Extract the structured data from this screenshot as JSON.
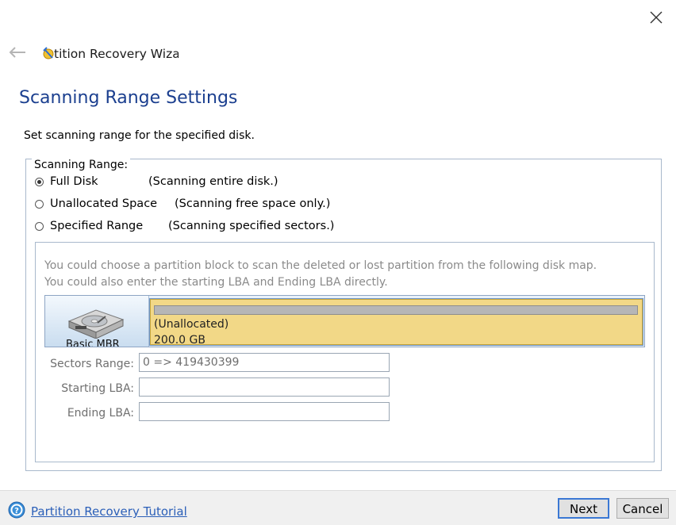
{
  "window": {
    "title": "Partition Recovery Wizard"
  },
  "header": {
    "app_title": "tition Recovery Wiza",
    "page_title": "Scanning Range Settings",
    "subtitle": "Set scanning range for the specified disk."
  },
  "scanning_range": {
    "legend": "Scanning Range:",
    "options": [
      {
        "label": "Full Disk",
        "description": "(Scanning entire disk.)",
        "selected": true
      },
      {
        "label": "Unallocated Space",
        "description": "(Scanning free space only.)",
        "selected": false
      },
      {
        "label": "Specified Range",
        "description": "(Scanning specified sectors.)",
        "selected": false
      }
    ]
  },
  "specified_range": {
    "info_line1": "You could choose a partition block to scan the deleted or lost partition from the following disk map.",
    "info_line2": "You could also enter the starting LBA and Ending LBA directly.",
    "disk": {
      "label": "Basic MBR",
      "partition_name": "(Unallocated)",
      "partition_size": "200.0 GB"
    },
    "fields": {
      "sectors_range_label": "Sectors Range:",
      "sectors_range_value": "0 => 419430399",
      "starting_lba_label": "Starting LBA:",
      "starting_lba_value": "",
      "ending_lba_label": "Ending LBA:",
      "ending_lba_value": ""
    }
  },
  "footer": {
    "tutorial_link": "Partition Recovery Tutorial",
    "next_label": "Next",
    "cancel_label": "Cancel"
  },
  "colors": {
    "title_blue": "#1b3f8f",
    "link_blue": "#2b5fb8",
    "partition_fill": "#f2d887",
    "border": "#a9b9cc"
  },
  "icons": {
    "close": "close-icon",
    "back": "back-arrow-icon",
    "app": "partition-wizard-icon",
    "disk": "hard-disk-icon",
    "help": "help-icon"
  }
}
